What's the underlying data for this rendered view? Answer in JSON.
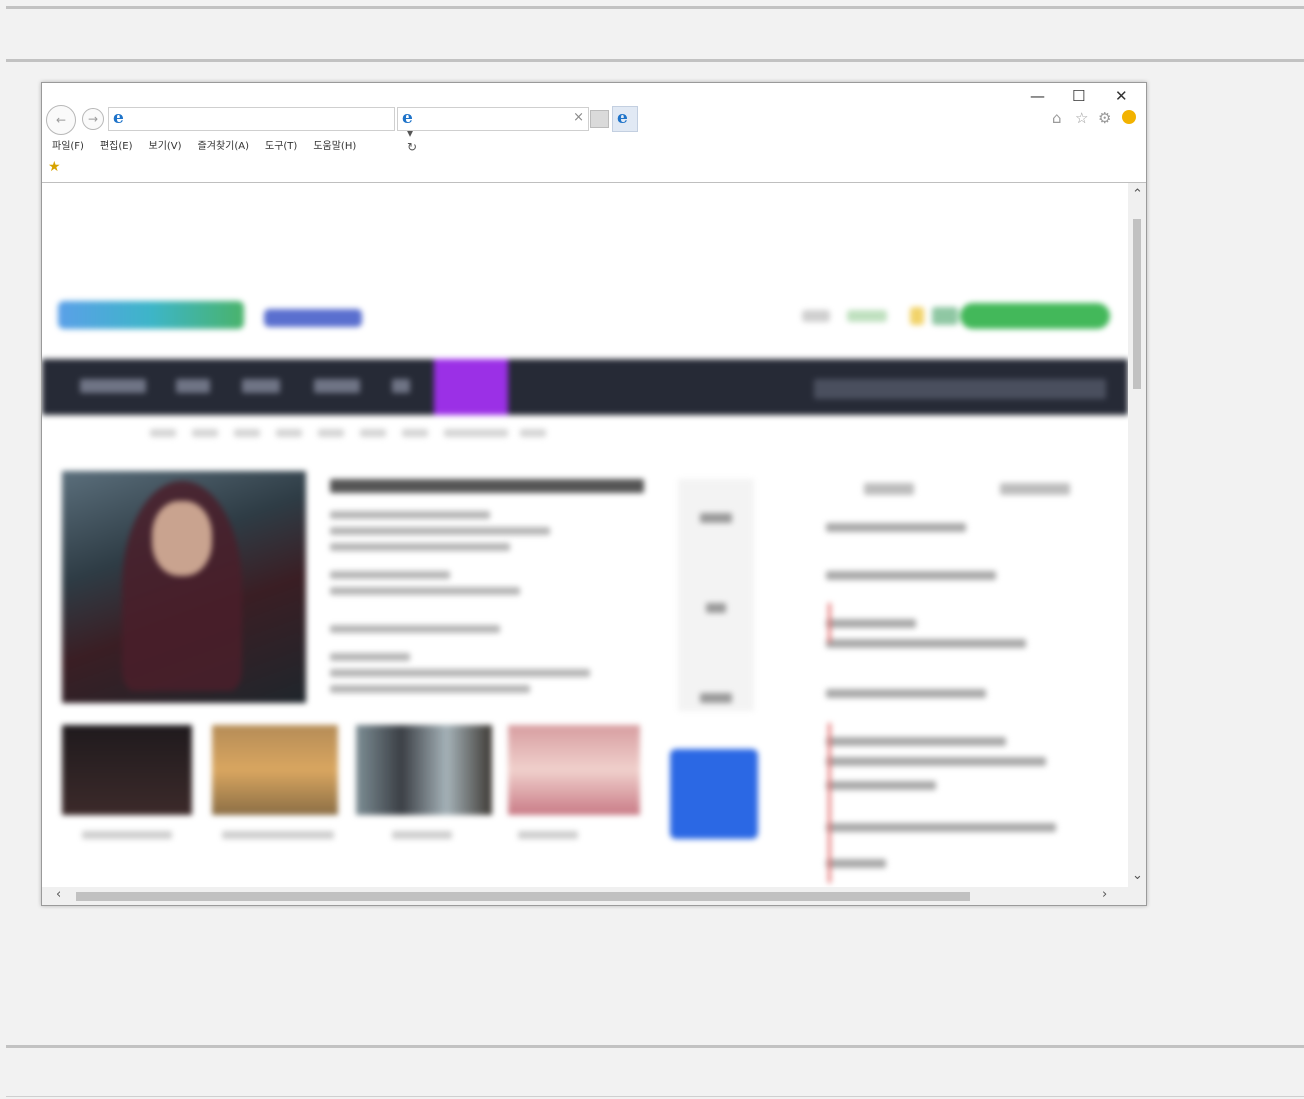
{
  "browser": {
    "menu": [
      {
        "label": "파일(F)"
      },
      {
        "label": "편집(E)"
      },
      {
        "label": "보기(V)"
      },
      {
        "label": "즐겨찾기(A)"
      },
      {
        "label": "도구(T)"
      },
      {
        "label": "도움말(H)"
      }
    ],
    "address_tools": "⌕ ▾ ↻",
    "tab_close": "×",
    "window_controls": {
      "minimize": "—",
      "maximize": "☐",
      "close": "✕"
    },
    "right_tools": {
      "home": "⌂",
      "favorites": "☆",
      "settings": "⚙"
    },
    "back_glyph": "←",
    "forward_glyph": "→",
    "ie_logo": "e",
    "favorites_bar_icon": "★"
  },
  "scrollbars": {
    "up": "⌃",
    "down": "⌄",
    "left": "‹",
    "right": "›",
    "horizontal_position": 0.0,
    "vertical_position": 0.0
  },
  "colors": {
    "nav_bar": "#262a36",
    "nav_active": "#9b30e6",
    "join_button": "#43b85a",
    "promo_box": "#2b68e4"
  }
}
